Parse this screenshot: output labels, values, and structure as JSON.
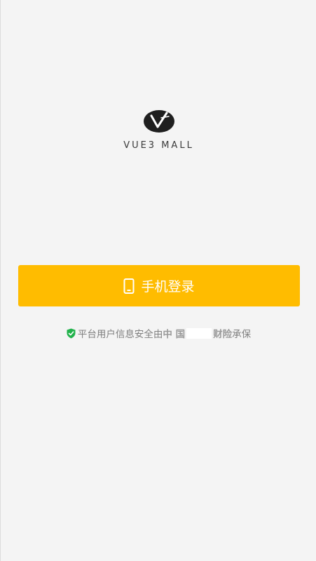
{
  "logo": {
    "text": "VUE3 MALL"
  },
  "login": {
    "button_label": "手机登录"
  },
  "notice": {
    "prefix": "平台用户信息安全由",
    "brand_a": "中 国",
    "brand_b": "财险",
    "suffix": "承保"
  },
  "colors": {
    "background": "#f4f4f4",
    "accent": "#ffbc00",
    "shield": "#21b24b"
  },
  "icons": {
    "phone": "phone-icon",
    "shield": "shield-check-icon"
  }
}
